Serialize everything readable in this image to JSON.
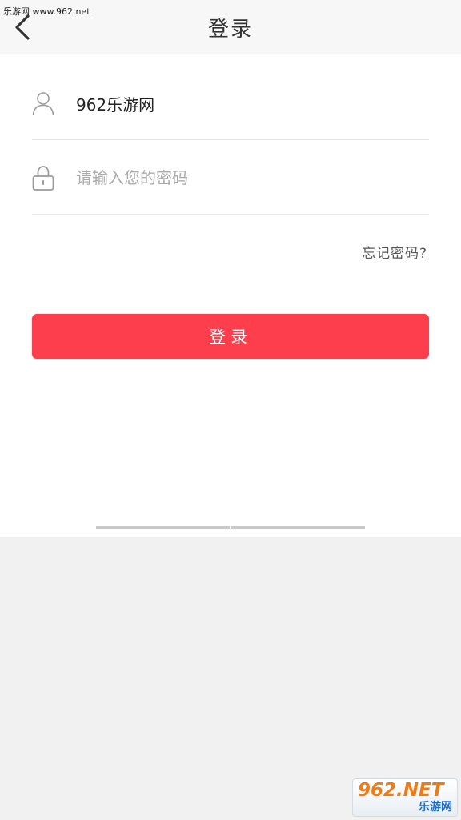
{
  "watermark": {
    "top_text": "乐游网 www.962.net",
    "logo_main": "962.NET",
    "logo_sub": "乐游网"
  },
  "header": {
    "title": "登录",
    "back_icon": "chevron-left-icon"
  },
  "form": {
    "username": {
      "value": "962乐游网",
      "icon": "user-icon"
    },
    "password": {
      "value": "",
      "placeholder": "请输入您的密码",
      "icon": "lock-icon"
    },
    "forgot_label": "忘记密码?",
    "submit_label": "登录"
  },
  "colors": {
    "accent": "#fd3e4c",
    "header_bg": "#f7f7f7",
    "page_bg": "#f1f1f1"
  }
}
